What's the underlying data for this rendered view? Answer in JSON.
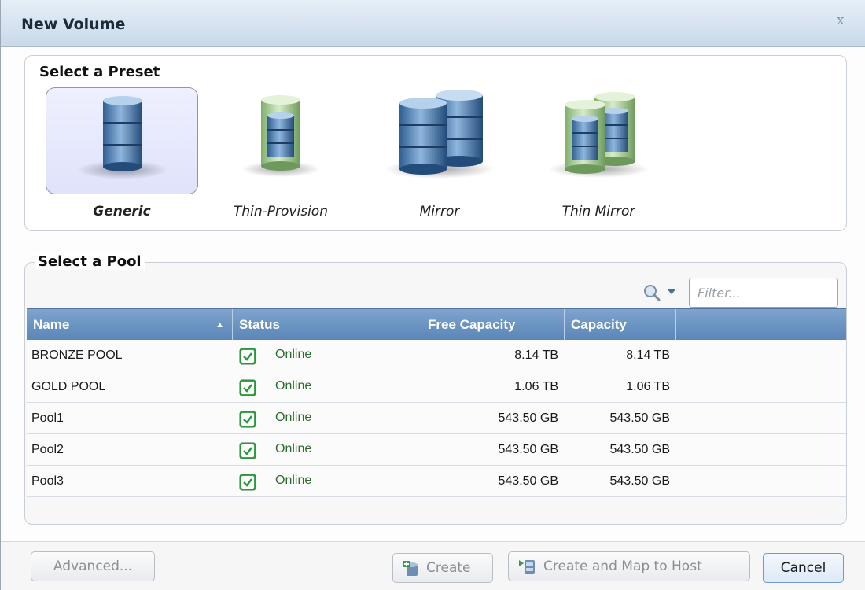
{
  "dialog": {
    "title": "New Volume",
    "close_glyph": "x"
  },
  "presets": {
    "section_title": "Select a Preset",
    "items": [
      {
        "label": "Generic",
        "icon": "generic-volume-icon",
        "selected": true
      },
      {
        "label": "Thin-Provision",
        "icon": "thin-provision-icon",
        "selected": false
      },
      {
        "label": "Mirror",
        "icon": "mirror-volume-icon",
        "selected": false
      },
      {
        "label": "Thin Mirror",
        "icon": "thin-mirror-icon",
        "selected": false
      }
    ]
  },
  "pools": {
    "section_title": "Select a Pool",
    "filter_placeholder": "Filter...",
    "columns": [
      "Name",
      "Status",
      "Free Capacity",
      "Capacity"
    ],
    "sorted_column": "Name",
    "rows": [
      {
        "name": "BRONZE POOL",
        "status": "Online",
        "free": "8.14 TB",
        "capacity": "8.14 TB"
      },
      {
        "name": "GOLD POOL",
        "status": "Online",
        "free": "1.06 TB",
        "capacity": "1.06 TB"
      },
      {
        "name": "Pool1",
        "status": "Online",
        "free": "543.50 GB",
        "capacity": "543.50 GB"
      },
      {
        "name": "Pool2",
        "status": "Online",
        "free": "543.50 GB",
        "capacity": "543.50 GB"
      },
      {
        "name": "Pool3",
        "status": "Online",
        "free": "543.50 GB",
        "capacity": "543.50 GB"
      }
    ]
  },
  "footer": {
    "advanced_label": "Advanced...",
    "create_label": "Create",
    "create_map_label": "Create and Map to Host",
    "cancel_label": "Cancel"
  },
  "colors": {
    "header_blue": "#5b86b8",
    "online_green": "#2e6b2e",
    "check_green": "#3aa84a"
  }
}
